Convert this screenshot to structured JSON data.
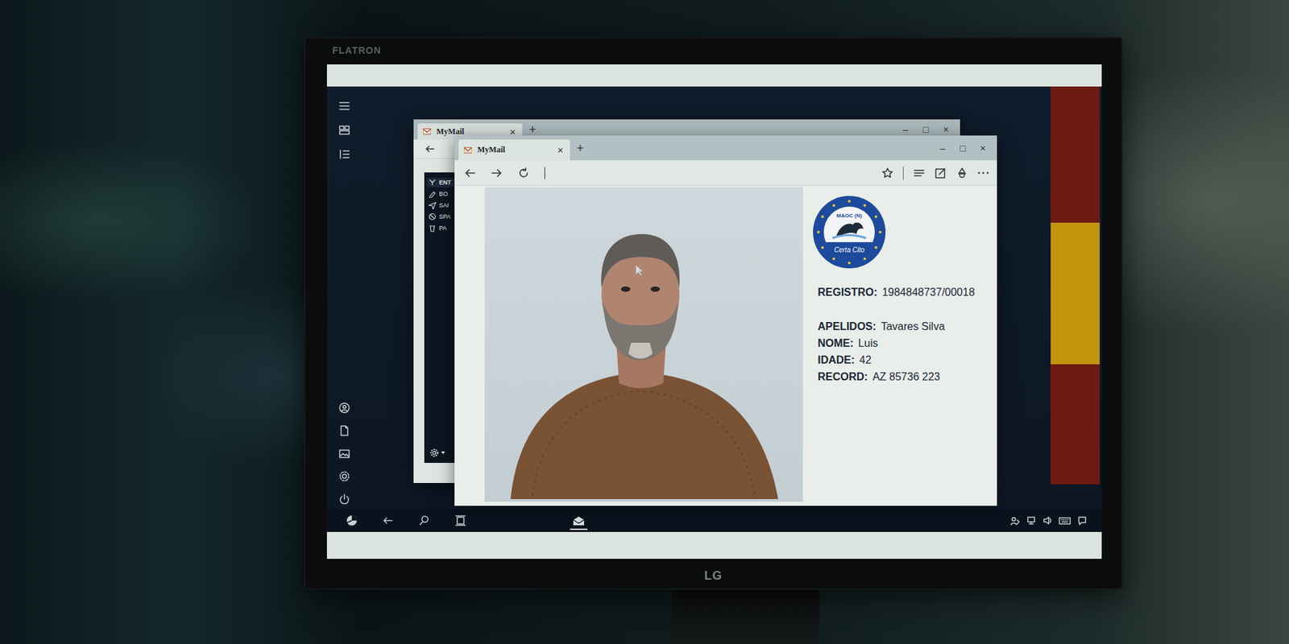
{
  "monitor": {
    "brand": "FLATRON",
    "logo": "LG"
  },
  "taskbar": {
    "mail": {
      "selected": true
    }
  },
  "back_window": {
    "tab": {
      "label": "MyMail",
      "close": "×",
      "selected": true
    },
    "new_tab": "+",
    "controls": [
      "–",
      "□",
      "×"
    ],
    "folders": [
      {
        "label": "ENT",
        "selected": true
      },
      {
        "label": "BO",
        "selected": false
      },
      {
        "label": "SAI",
        "selected": false
      },
      {
        "label": "SPA",
        "selected": false
      },
      {
        "label": "PA",
        "selected": false
      }
    ]
  },
  "front_window": {
    "tab": {
      "label": "MyMail",
      "close": "×",
      "selected": true
    },
    "new_tab": "+",
    "controls": [
      "–",
      "□",
      "×"
    ],
    "more": "···",
    "record": {
      "badge": {
        "top": "MAOC (N)",
        "bottom": "Certa Cito"
      },
      "fields": [
        {
          "label": "REGISTRO:",
          "value": "1984848737/00018"
        },
        {
          "label": "APELIDOS:",
          "value": "Tavares Silva"
        },
        {
          "label": "NOME:",
          "value": "Luis"
        },
        {
          "label": "IDADE:",
          "value": "42"
        },
        {
          "label": "RECORD:",
          "value": "AZ 85736 223"
        }
      ]
    }
  }
}
